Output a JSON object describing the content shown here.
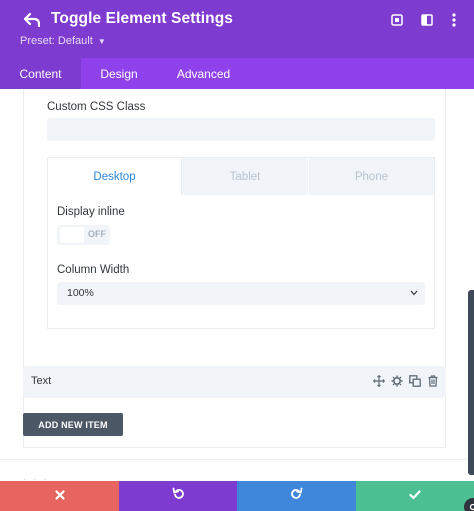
{
  "header": {
    "title": "Toggle Element Settings",
    "preset_label": "Preset: Default",
    "icons": [
      "back-arrow-icon",
      "expand-icon",
      "sidebar-icon",
      "more-icon"
    ]
  },
  "tabs": [
    {
      "label": "Content",
      "active": true
    },
    {
      "label": "Design",
      "active": false
    },
    {
      "label": "Advanced",
      "active": false
    }
  ],
  "content": {
    "custom_css_class": {
      "label": "Custom CSS Class",
      "value": ""
    },
    "responsive_tabs": [
      {
        "label": "Desktop",
        "active": true
      },
      {
        "label": "Tablet",
        "active": false
      },
      {
        "label": "Phone",
        "active": false
      }
    ],
    "display_inline": {
      "label": "Display inline",
      "state": "OFF"
    },
    "column_width": {
      "label": "Column Width",
      "value": "100%"
    }
  },
  "item": {
    "label": "Text",
    "actions": [
      "move-icon",
      "settings-icon",
      "duplicate-icon",
      "delete-icon"
    ]
  },
  "add_button": {
    "label": "ADD NEW ITEM"
  },
  "footer": [
    {
      "name": "discard",
      "icon": "close-icon",
      "color": "#e86460"
    },
    {
      "name": "undo",
      "icon": "undo-icon",
      "color": "#7e3bd0"
    },
    {
      "name": "redo",
      "icon": "redo-icon",
      "color": "#3f87da"
    },
    {
      "name": "save",
      "icon": "check-icon",
      "color": "#4dc093"
    }
  ],
  "colors": {
    "header": "#7e3bd0",
    "tabs": "#8f42ec",
    "accent_blue": "#2b87da",
    "input_bg": "#f1f5f9"
  }
}
